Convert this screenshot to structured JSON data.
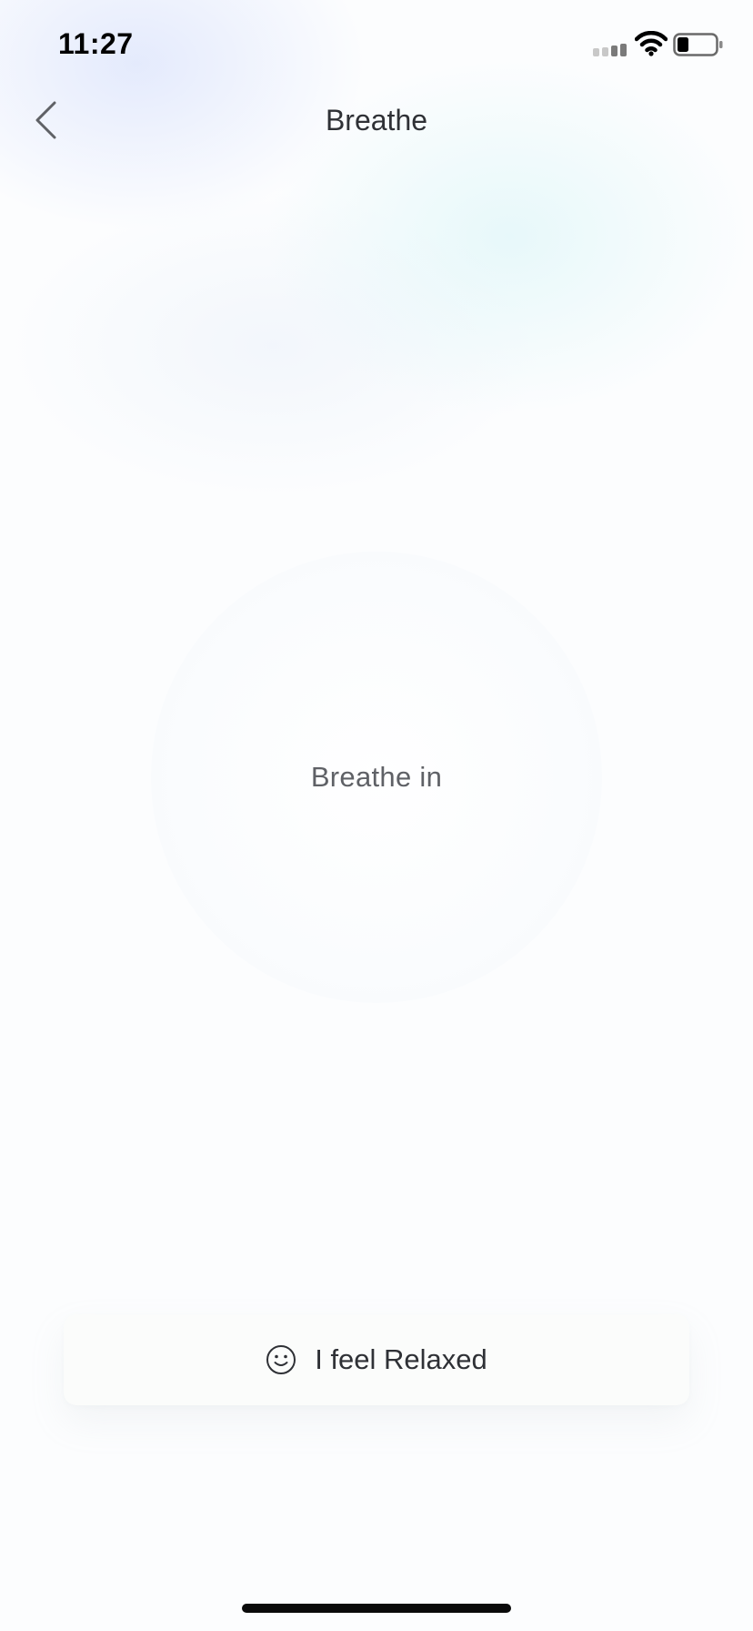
{
  "status_bar": {
    "time": "11:27"
  },
  "nav": {
    "title": "Breathe",
    "back_icon": "chevron-left-icon"
  },
  "breathing": {
    "instruction": "Breathe in"
  },
  "actions": {
    "relaxed_label": "I feel Relaxed",
    "relaxed_icon": "smile-icon"
  },
  "colors": {
    "text_primary": "#2f3136",
    "text_secondary": "#5f6166",
    "background": "#fcfdfe"
  }
}
